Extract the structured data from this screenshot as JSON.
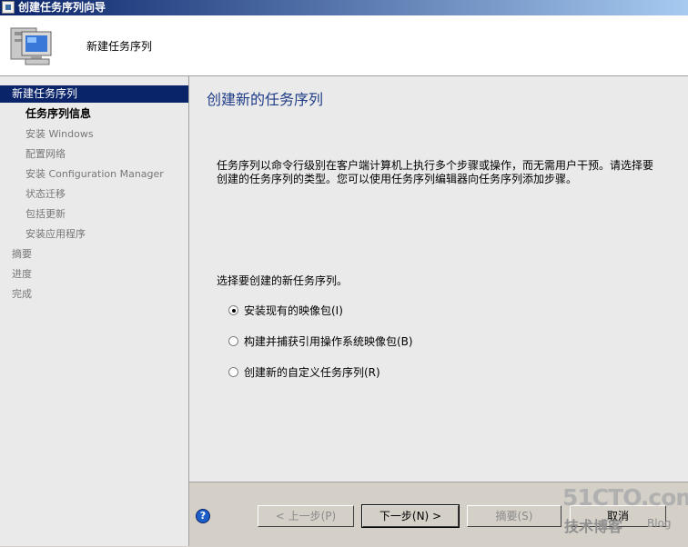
{
  "window": {
    "title": "创建任务序列向导"
  },
  "header": {
    "title": "新建任务序列"
  },
  "sidebar": {
    "items": [
      {
        "label": "新建任务序列"
      },
      {
        "label": "任务序列信息"
      },
      {
        "label": "安装 Windows"
      },
      {
        "label": "配置网络"
      },
      {
        "label": "安装 Configuration Manager"
      },
      {
        "label": "状态迁移"
      },
      {
        "label": "包括更新"
      },
      {
        "label": "安装应用程序"
      },
      {
        "label": "摘要"
      },
      {
        "label": "进度"
      },
      {
        "label": "完成"
      }
    ]
  },
  "main": {
    "title": "创建新的任务序列",
    "description": "任务序列以命令行级别在客户端计算机上执行多个步骤或操作，而无需用户干预。请选择要创建的任务序列的类型。您可以使用任务序列编辑器向任务序列添加步骤。",
    "prompt": "选择要创建的新任务序列。",
    "options": [
      {
        "label": "安装现有的映像包(I)",
        "selected": true
      },
      {
        "label": "构建并捕获引用操作系统映像包(B)",
        "selected": false
      },
      {
        "label": "创建新的自定义任务序列(R)",
        "selected": false
      }
    ]
  },
  "footer": {
    "help": "?",
    "prev_label": "< 上一步(P)",
    "next_label": "下一步(N) >",
    "summary_label": "摘要(S)",
    "cancel_label": "取消"
  },
  "watermark": {
    "line1": "51CTO.com",
    "line2": "技术博客",
    "line3": "Blog"
  }
}
